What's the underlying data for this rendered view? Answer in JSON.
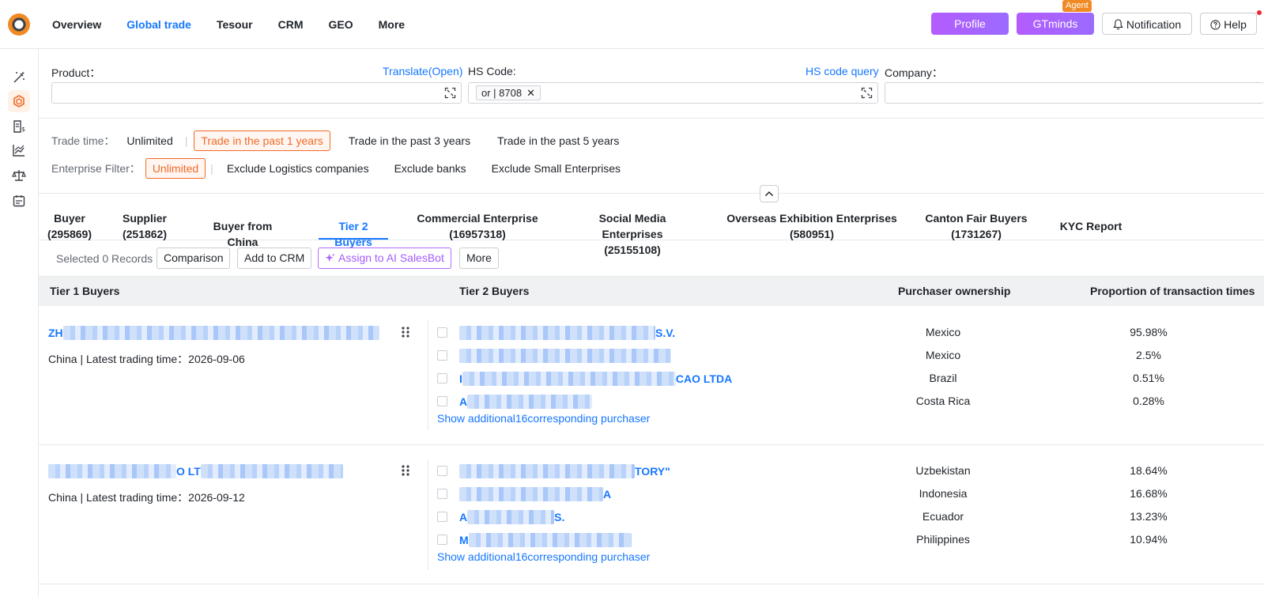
{
  "header": {
    "nav": [
      "Overview",
      "Global trade",
      "Tesour",
      "CRM",
      "GEO",
      "More"
    ],
    "active_nav": "Global trade",
    "profile_label": "Profile",
    "gtminds_label": "GTminds",
    "agent_badge": "Agent",
    "notification_label": "Notification",
    "help_label": "Help"
  },
  "rail": {
    "icons": [
      "magic-wand-icon",
      "cube-icon",
      "receipt-dollar-icon",
      "line-chart-icon",
      "scale-icon",
      "calendar-icon"
    ]
  },
  "search": {
    "product_label": "Product：",
    "translate_link": "Translate(Open)",
    "hs_label": "HS Code:",
    "hs_query_link": "HS code query",
    "hs_tag": "or | 8708",
    "company_label": "Company："
  },
  "filters": {
    "trade_time_label": "Trade time：",
    "trade_time_options": [
      "Unlimited",
      "Trade in the past 1 years",
      "Trade in the past 3 years",
      "Trade in the past 5 years"
    ],
    "trade_time_selected": 1,
    "enterprise_label": "Enterprise Filter：",
    "enterprise_options": [
      "Unlimited",
      "Exclude Logistics companies",
      "Exclude banks",
      "Exclude Small Enterprises"
    ],
    "enterprise_selected": 0
  },
  "tabs": [
    {
      "label": "Buyer",
      "count": "(295869)"
    },
    {
      "label": "Supplier",
      "count": "(251862)"
    },
    {
      "label": "Buyer from China",
      "count": ""
    },
    {
      "label": "Tier 2 Buyers",
      "count": ""
    },
    {
      "label": "Commercial Enterprise",
      "count": "(16957318)"
    },
    {
      "label": "Social Media Enterprises",
      "count": "(25155108)"
    },
    {
      "label": "Overseas Exhibition Enterprises",
      "count": "(580951)"
    },
    {
      "label": "Canton Fair Buyers",
      "count": "(1731267)"
    },
    {
      "label": "KYC Report",
      "count": ""
    }
  ],
  "active_tab": 3,
  "actions": {
    "selected": "Selected 0 Records",
    "comparison": "Comparison",
    "add_crm": "Add to CRM",
    "assign_ai": "Assign to AI SalesBot",
    "more": "More"
  },
  "table": {
    "headers": [
      "Tier 1 Buyers",
      "Tier 2 Buyers",
      "Purchaser ownership",
      "Proportion of transaction times"
    ],
    "groups": [
      {
        "tier1_prefix": "ZH",
        "tier1_suffix": "",
        "meta": "China | Latest trading time：2026-09-06",
        "rows": [
          {
            "name_suffix": "S.V.",
            "country": "Mexico",
            "pct": "95.98%"
          },
          {
            "name_suffix": "",
            "country": "Mexico",
            "pct": "2.5%"
          },
          {
            "name_prefix": "I",
            "name_suffix": "CAO LTDA",
            "country": "Brazil",
            "pct": "0.51%"
          },
          {
            "name_prefix": "A",
            "name_suffix": "",
            "country": "Costa Rica",
            "pct": "0.28%"
          }
        ],
        "more": "Show additional16corresponding purchaser"
      },
      {
        "tier1_prefix": "",
        "tier1_mid": "O LT",
        "meta": "China | Latest trading time：2026-09-12",
        "rows": [
          {
            "name_suffix": "TORY\"",
            "country": "Uzbekistan",
            "pct": "18.64%"
          },
          {
            "name_suffix": "A",
            "country": "Indonesia",
            "pct": "16.68%"
          },
          {
            "name_prefix": "A",
            "name_suffix": "S.",
            "country": "Ecuador",
            "pct": "13.23%"
          },
          {
            "name_prefix": "M",
            "name_suffix": "",
            "country": "Philippines",
            "pct": "10.94%"
          }
        ],
        "more": "Show additional16corresponding purchaser"
      }
    ]
  },
  "colors": {
    "accent": "#1677ff",
    "selected_filter": "#f06a28",
    "ai_purple": "#a45cff"
  }
}
